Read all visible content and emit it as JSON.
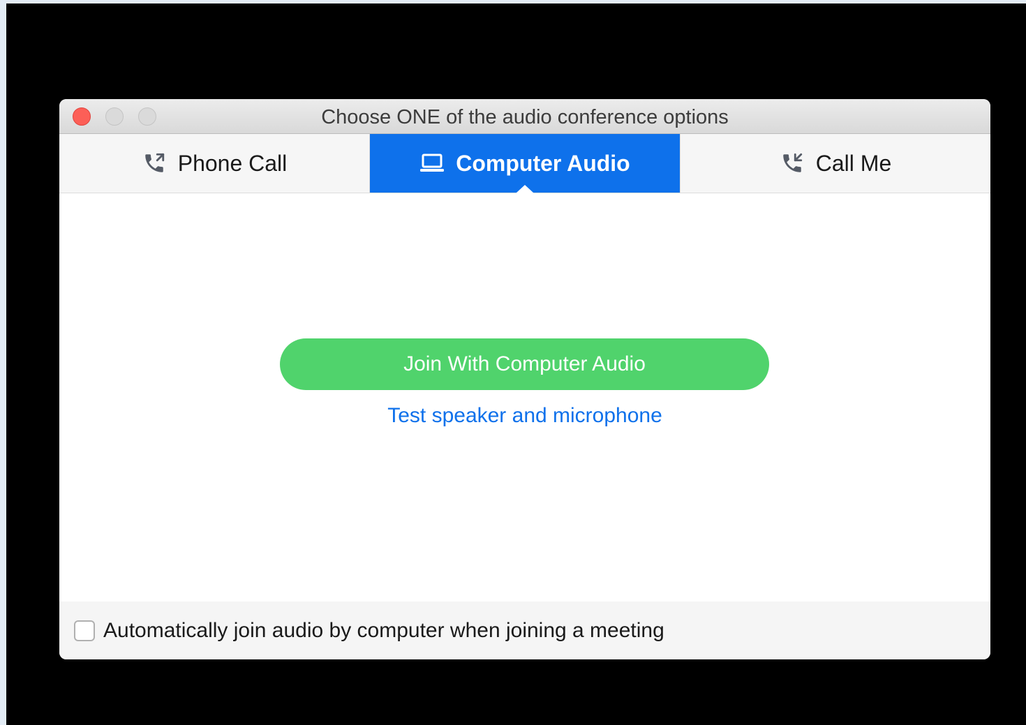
{
  "window": {
    "title": "Choose ONE of the audio conference options"
  },
  "tabs": [
    {
      "label": "Phone Call",
      "icon": "phone-outgoing-icon",
      "active": false
    },
    {
      "label": "Computer Audio",
      "icon": "laptop-icon",
      "active": true
    },
    {
      "label": "Call Me",
      "icon": "phone-incoming-icon",
      "active": false
    }
  ],
  "main": {
    "join_button_label": "Join With Computer Audio",
    "test_link_label": "Test speaker and microphone"
  },
  "footer": {
    "checkbox_label": "Automatically join audio by computer when joining a meeting",
    "checked": false
  },
  "colors": {
    "accent_blue": "#0e71eb",
    "join_green": "#50d36c",
    "close_red": "#fc5f57"
  }
}
